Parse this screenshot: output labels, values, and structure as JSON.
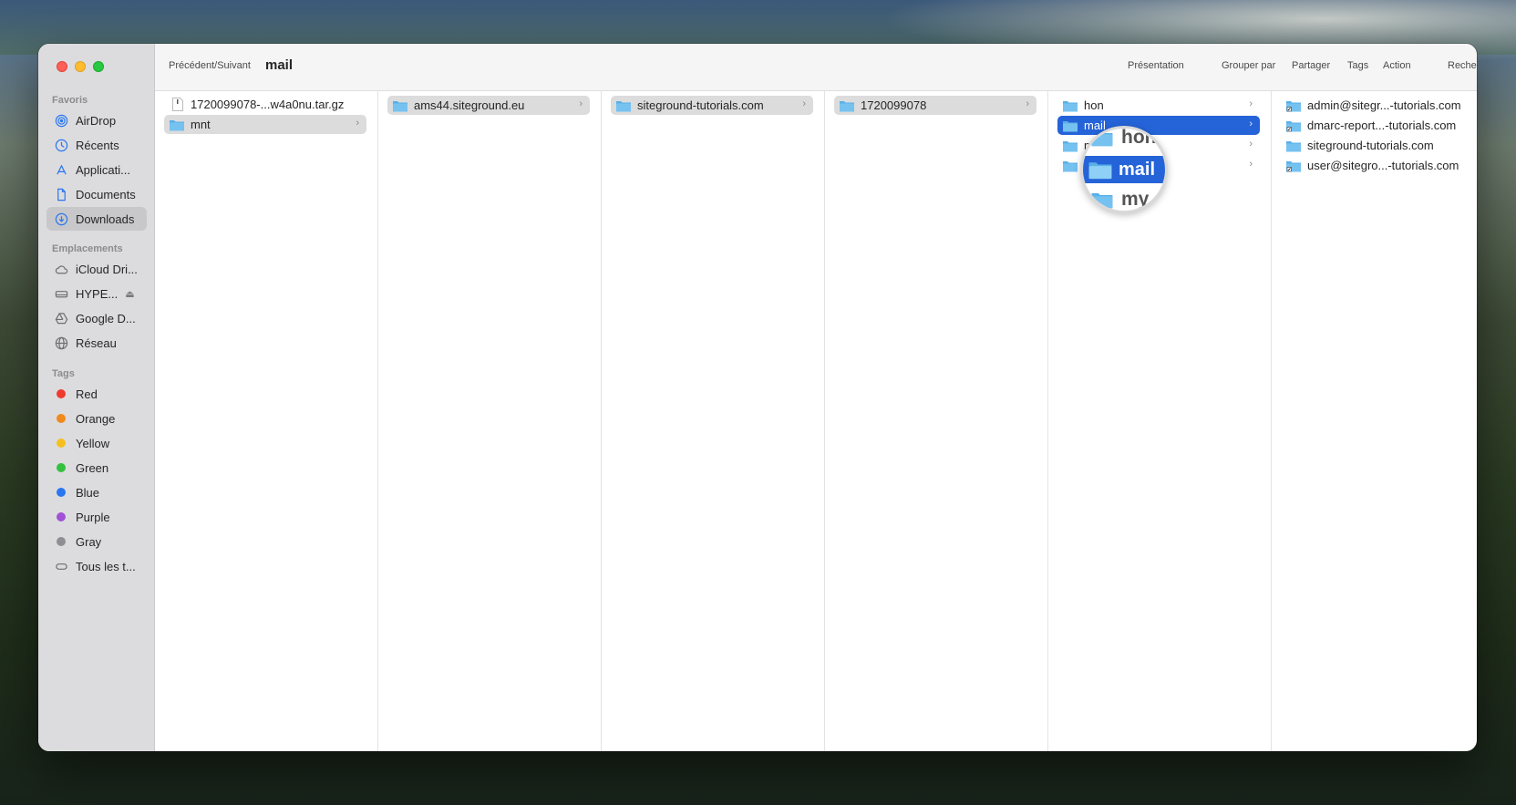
{
  "window": {
    "nav_label": "Précédent/Suivant",
    "title": "mail"
  },
  "toolbar": {
    "presentation": "Présentation",
    "group_by": "Grouper par",
    "share": "Partager",
    "tags": "Tags",
    "action": "Action",
    "search": "Rechercher"
  },
  "sidebar": {
    "favorites_title": "Favoris",
    "favorites": [
      {
        "label": "AirDrop",
        "icon": "airdrop-icon"
      },
      {
        "label": "Récents",
        "icon": "clock-icon"
      },
      {
        "label": "Applicati...",
        "icon": "applications-icon"
      },
      {
        "label": "Documents",
        "icon": "document-icon"
      },
      {
        "label": "Downloads",
        "icon": "download-icon"
      }
    ],
    "locations_title": "Emplacements",
    "locations": [
      {
        "label": "iCloud Dri...",
        "icon": "cloud-icon"
      },
      {
        "label": "HYPE...",
        "icon": "disk-icon"
      },
      {
        "label": "Google D...",
        "icon": "google-drive-icon"
      },
      {
        "label": "Réseau",
        "icon": "network-icon"
      }
    ],
    "tags_title": "Tags",
    "tags": [
      {
        "label": "Red",
        "color": "#ee3a2f"
      },
      {
        "label": "Orange",
        "color": "#f08a1c"
      },
      {
        "label": "Yellow",
        "color": "#f5c01f"
      },
      {
        "label": "Green",
        "color": "#33c13e"
      },
      {
        "label": "Blue",
        "color": "#2a76f0"
      },
      {
        "label": "Purple",
        "color": "#a051d6"
      },
      {
        "label": "Gray",
        "color": "#8e8e93"
      },
      {
        "label": "Tous les t...",
        "color": ""
      }
    ]
  },
  "columns": [
    {
      "items": [
        {
          "label": "1720099078-...w4a0nu.tar.gz",
          "type": "file"
        },
        {
          "label": "mnt",
          "type": "folder",
          "selected": true
        }
      ]
    },
    {
      "items": [
        {
          "label": "ams44.siteground.eu",
          "type": "folder",
          "selected": true
        }
      ]
    },
    {
      "items": [
        {
          "label": "siteground-tutorials.com",
          "type": "folder",
          "selected": true
        }
      ]
    },
    {
      "items": [
        {
          "label": "1720099078",
          "type": "folder",
          "selected": true
        }
      ]
    },
    {
      "items": [
        {
          "label": "hon",
          "type": "folder"
        },
        {
          "label": "mail",
          "type": "folder",
          "active": true
        },
        {
          "label": "my",
          "type": "folder"
        },
        {
          "label": "pgsql",
          "type": "folder"
        }
      ]
    },
    {
      "items": [
        {
          "label": "admin@sitegr...-tutorials.com",
          "type": "folder-alias"
        },
        {
          "label": "dmarc-report...-tutorials.com",
          "type": "folder-alias"
        },
        {
          "label": "siteground-tutorials.com",
          "type": "folder"
        },
        {
          "label": "user@sitegro...-tutorials.com",
          "type": "folder-alias"
        }
      ]
    }
  ]
}
